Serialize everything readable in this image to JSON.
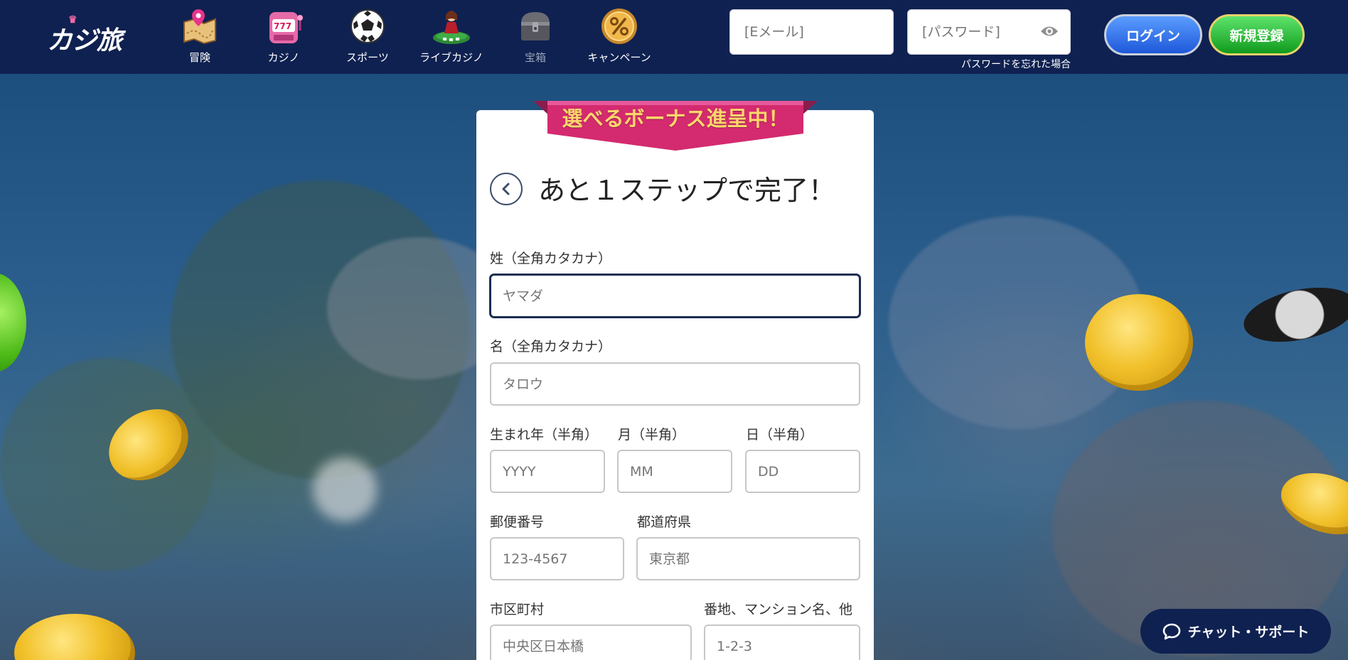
{
  "header": {
    "logo_text": "カジ旅",
    "nav": [
      {
        "label": "冒険",
        "icon": "map-icon"
      },
      {
        "label": "カジノ",
        "icon": "slot-machine-icon"
      },
      {
        "label": "スポーツ",
        "icon": "soccer-ball-icon"
      },
      {
        "label": "ライブカジノ",
        "icon": "live-dealer-icon"
      },
      {
        "label": "宝箱",
        "icon": "treasure-chest-icon"
      },
      {
        "label": "キャンペーン",
        "icon": "percent-coin-icon"
      }
    ],
    "email_placeholder": "[Eメール]",
    "password_placeholder": "[パスワード]",
    "forgot_password": "パスワードを忘れた場合",
    "login_label": "ログイン",
    "register_label": "新規登録"
  },
  "colors": {
    "header_bg": "#0f2151",
    "ribbon": "#d42a6f",
    "login_button": "#2a6df0",
    "register_button": "#1fb52b"
  },
  "form": {
    "ribbon": "選べるボーナス進呈中！",
    "title": "あと１ステップで完了！",
    "last_name": {
      "label": "姓（全角カタカナ）",
      "placeholder": "ヤマダ"
    },
    "first_name": {
      "label": "名（全角カタカナ）",
      "placeholder": "タロウ"
    },
    "birth_year": {
      "label": "生まれ年（半角）",
      "placeholder": "YYYY"
    },
    "birth_month": {
      "label": "月（半角）",
      "placeholder": "MM"
    },
    "birth_day": {
      "label": "日（半角）",
      "placeholder": "DD"
    },
    "postal_code": {
      "label": "郵便番号",
      "placeholder": "123-4567"
    },
    "prefecture": {
      "label": "都道府県",
      "placeholder": "東京都"
    },
    "city": {
      "label": "市区町村",
      "placeholder": "中央区日本橋"
    },
    "address": {
      "label": "番地、マンション名、他",
      "placeholder": "1-2-3"
    }
  },
  "chat": {
    "label": "チャット・サポート"
  }
}
